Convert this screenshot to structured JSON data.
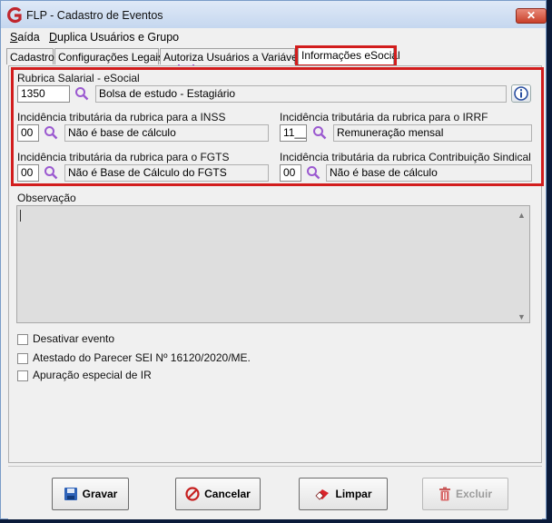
{
  "window": {
    "title": "FLP - Cadastro de Eventos",
    "close_symbol": "✕"
  },
  "menu": {
    "items": [
      {
        "label": "Saída",
        "accel": "S"
      },
      {
        "label": "Duplica Usuários e Grupo",
        "accel": "D"
      }
    ]
  },
  "tabs": [
    {
      "label": "Cadastro"
    },
    {
      "label": "Configurações Legais"
    },
    {
      "label": "Autoriza Usuários a Variáveis"
    },
    {
      "label": "Informações eSocial",
      "active": true
    }
  ],
  "esocial": {
    "rubrica_label": "Rubrica Salarial - eSocial",
    "rubrica_code": "1350",
    "rubrica_desc": "Bolsa de estudo - Estagiário",
    "inss_label": "Incidência tributária da rubrica para a INSS",
    "inss_code": "00",
    "inss_desc": "Não é base de cálculo",
    "irrf_label": "Incidência tributária da rubrica para o IRRF",
    "irrf_code": "11__",
    "irrf_desc": "Remuneração mensal",
    "fgts_label": "Incidência tributária da rubrica para o FGTS",
    "fgts_code": "00",
    "fgts_desc": "Não é Base de Cálculo do FGTS",
    "sindical_label": "Incidência tributária da rubrica Contribuição Sindical",
    "sindical_code": "00",
    "sindical_desc": "Não é base de cálculo"
  },
  "observacao": {
    "label": "Observação",
    "value": ""
  },
  "checkboxes": [
    {
      "label": "Desativar evento",
      "checked": false
    },
    {
      "label": "Atestado do Parecer SEI Nº 16120/2020/ME.",
      "checked": false
    },
    {
      "label": "Apuração especial de IR",
      "checked": false
    }
  ],
  "buttons": {
    "gravar": "Gravar",
    "cancelar": "Cancelar",
    "limpar": "Limpar",
    "excluir": "Excluir"
  },
  "colors": {
    "highlight": "#d21d1d",
    "lens": "#9b59d0"
  }
}
